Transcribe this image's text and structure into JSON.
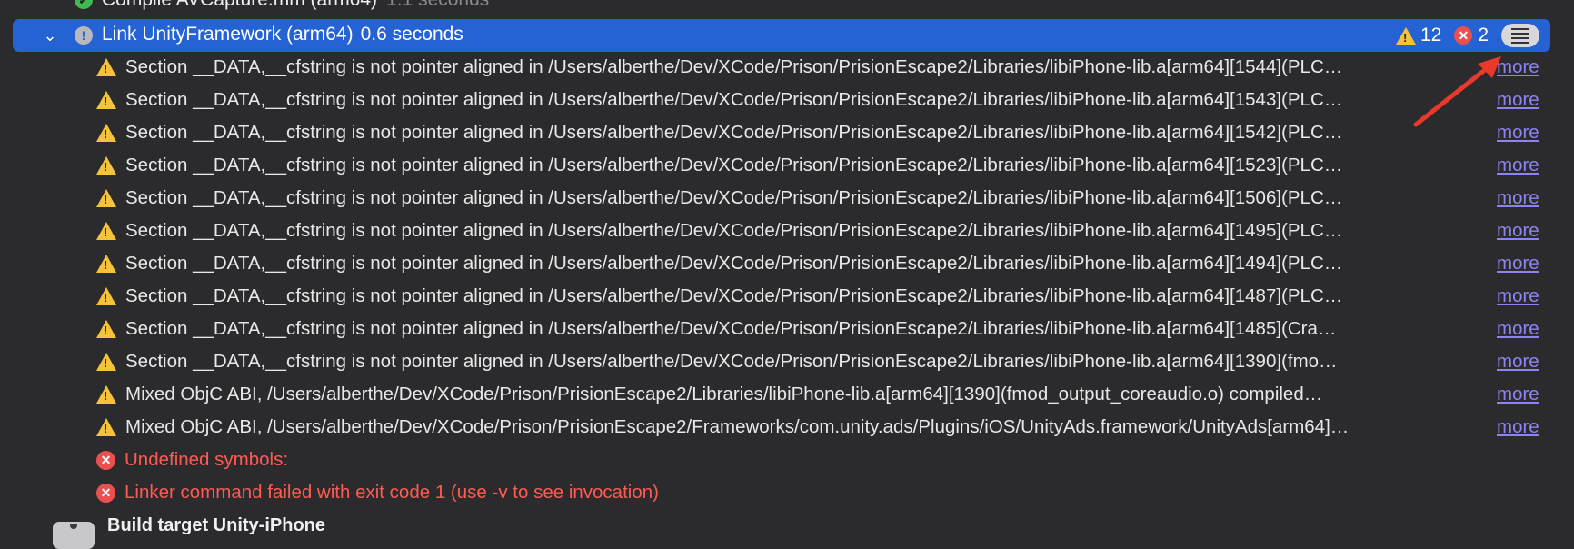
{
  "prev_row": {
    "title": "Compile AVCapture.mm (arm64)",
    "duration": "1.1 seconds"
  },
  "selected_row": {
    "title": "Link UnityFramework (arm64)",
    "duration": "0.6 seconds",
    "warning_count": "12",
    "error_count": "2"
  },
  "messages": [
    {
      "type": "warning",
      "text": "Section __DATA,__cfstring is not pointer aligned in /Users/alberthe/Dev/XCode/Prison/PrisionEscape2/Libraries/libiPhone-lib.a[arm64][1544](PLC…",
      "more": "more"
    },
    {
      "type": "warning",
      "text": "Section __DATA,__cfstring is not pointer aligned in /Users/alberthe/Dev/XCode/Prison/PrisionEscape2/Libraries/libiPhone-lib.a[arm64][1543](PLC…",
      "more": "more"
    },
    {
      "type": "warning",
      "text": "Section __DATA,__cfstring is not pointer aligned in /Users/alberthe/Dev/XCode/Prison/PrisionEscape2/Libraries/libiPhone-lib.a[arm64][1542](PLC…",
      "more": "more"
    },
    {
      "type": "warning",
      "text": "Section __DATA,__cfstring is not pointer aligned in /Users/alberthe/Dev/XCode/Prison/PrisionEscape2/Libraries/libiPhone-lib.a[arm64][1523](PLC…",
      "more": "more"
    },
    {
      "type": "warning",
      "text": "Section __DATA,__cfstring is not pointer aligned in /Users/alberthe/Dev/XCode/Prison/PrisionEscape2/Libraries/libiPhone-lib.a[arm64][1506](PLC…",
      "more": "more"
    },
    {
      "type": "warning",
      "text": "Section __DATA,__cfstring is not pointer aligned in /Users/alberthe/Dev/XCode/Prison/PrisionEscape2/Libraries/libiPhone-lib.a[arm64][1495](PLC…",
      "more": "more"
    },
    {
      "type": "warning",
      "text": "Section __DATA,__cfstring is not pointer aligned in /Users/alberthe/Dev/XCode/Prison/PrisionEscape2/Libraries/libiPhone-lib.a[arm64][1494](PLC…",
      "more": "more"
    },
    {
      "type": "warning",
      "text": "Section __DATA,__cfstring is not pointer aligned in /Users/alberthe/Dev/XCode/Prison/PrisionEscape2/Libraries/libiPhone-lib.a[arm64][1487](PLC…",
      "more": "more"
    },
    {
      "type": "warning",
      "text": "Section __DATA,__cfstring is not pointer aligned in /Users/alberthe/Dev/XCode/Prison/PrisionEscape2/Libraries/libiPhone-lib.a[arm64][1485](Cra…",
      "more": "more"
    },
    {
      "type": "warning",
      "text": "Section __DATA,__cfstring is not pointer aligned in /Users/alberthe/Dev/XCode/Prison/PrisionEscape2/Libraries/libiPhone-lib.a[arm64][1390](fmo…",
      "more": "more"
    },
    {
      "type": "warning",
      "text": "Mixed ObjC ABI, /Users/alberthe/Dev/XCode/Prison/PrisionEscape2/Libraries/libiPhone-lib.a[arm64][1390](fmod_output_coreaudio.o) compiled…",
      "more": "more"
    },
    {
      "type": "warning",
      "text": "Mixed ObjC ABI, /Users/alberthe/Dev/XCode/Prison/PrisionEscape2/Frameworks/com.unity.ads/Plugins/iOS/UnityAds.framework/UnityAds[arm64]…",
      "more": "more"
    },
    {
      "type": "error",
      "text": "Undefined symbols:",
      "more": ""
    },
    {
      "type": "error",
      "text": "Linker command failed with exit code 1 (use -v to see invocation)",
      "more": ""
    }
  ],
  "next_row": {
    "title": "Build target Unity-iPhone"
  },
  "colors": {
    "selection": "#2562d3",
    "warning": "#f5c33b",
    "error": "#eb4f4f",
    "link": "#8c84f0",
    "annotation_arrow": "#e8392b"
  }
}
